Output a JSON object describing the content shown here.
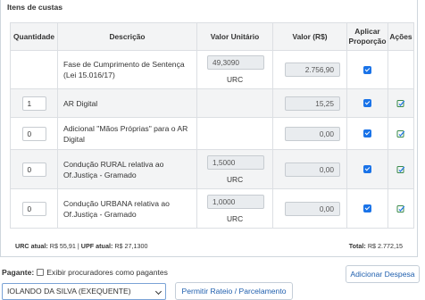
{
  "panel": {
    "title": "Itens de custas"
  },
  "table": {
    "headers": {
      "quantidade": "Quantidade",
      "descricao": "Descrição",
      "valor_unitario": "Valor Unitário",
      "valor": "Valor (R$)",
      "aplicar": "Aplicar Proporção",
      "acoes": "Ações"
    },
    "rows": [
      {
        "quantidade": "",
        "descricao": "Fase de Cumprimento de Sentença (Lei 15.016/17)",
        "valor_unitario": "49,3090",
        "unidade": "URC",
        "valor": "2.756,90",
        "aplicar": true,
        "acao": false
      },
      {
        "quantidade": "1",
        "descricao": "AR Digital",
        "valor_unitario": "",
        "unidade": "",
        "valor": "15,25",
        "aplicar": true,
        "acao": true
      },
      {
        "quantidade": "0",
        "descricao": "Adicional \"Mãos Próprias\" para o AR Digital",
        "valor_unitario": "",
        "unidade": "",
        "valor": "0,00",
        "aplicar": true,
        "acao": true
      },
      {
        "quantidade": "0",
        "descricao": "Condução RURAL relativa ao Of.Justiça - Gramado",
        "valor_unitario": "1,5000",
        "unidade": "URC",
        "valor": "0,00",
        "aplicar": true,
        "acao": true
      },
      {
        "quantidade": "0",
        "descricao": "Condução URBANA relativa ao Of.Justiça - Gramado",
        "valor_unitario": "1,0000",
        "unidade": "URC",
        "valor": "0,00",
        "aplicar": true,
        "acao": true
      }
    ]
  },
  "footer": {
    "urc_label": "URC atual:",
    "urc_value": "R$ 55,91",
    "separator": "|",
    "upf_label": "UPF atual:",
    "upf_value": "R$ 27,1300",
    "total_label": "Total:",
    "total_value": "R$ 2.772,15"
  },
  "pagante": {
    "label": "Pagante:",
    "checkbox_label": "Exibir procuradores como pagantes",
    "checkbox_checked": false,
    "selected": "IOLANDO DA SILVA (EXEQUENTE)"
  },
  "buttons": {
    "rateio": "Permitir Rateio / Parcelamento",
    "adicionar": "Adicionar Despesa"
  },
  "colors": {
    "accent": "#1a73e8",
    "link": "#1f5fae",
    "action_icon": "#3a8a4a"
  }
}
